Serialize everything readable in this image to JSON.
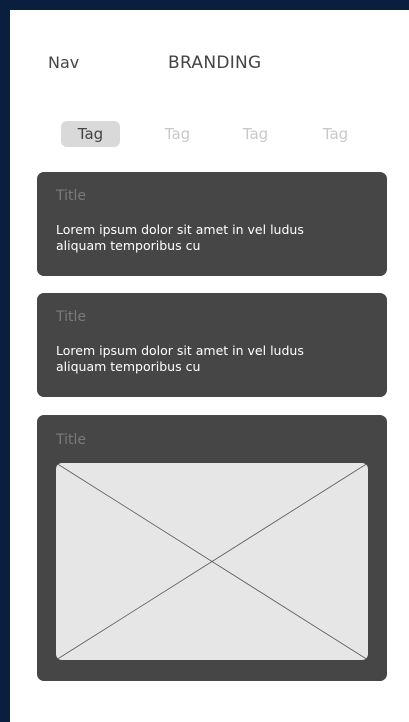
{
  "header": {
    "nav_label": "Nav",
    "brand": "BRANDING"
  },
  "tags": [
    "Tag",
    "Tag",
    "Tag",
    "Tag"
  ],
  "active_tag_index": 0,
  "cards": [
    {
      "title": "Title",
      "body": "Lorem ipsum dolor sit amet in vel ludus aliquam temporibus cu"
    },
    {
      "title": "Title",
      "body": "Lorem ipsum dolor sit amet in vel ludus aliquam temporibus cu"
    },
    {
      "title": "Title",
      "image": "image-placeholder"
    }
  ],
  "colors": {
    "frame": "#0a1f3e",
    "card": "#464646",
    "card_title": "#7a7a7a",
    "active_tag_bg": "#d9d9d9",
    "inactive_tag": "#c8c8c8",
    "placeholder": "#e6e6e6"
  }
}
